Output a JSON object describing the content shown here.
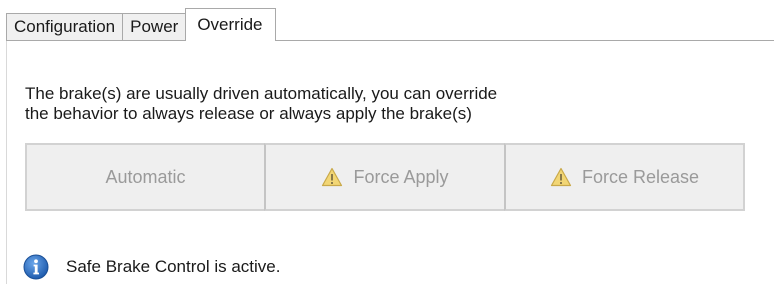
{
  "tabs": [
    {
      "label": "Configuration",
      "active": false
    },
    {
      "label": "Power",
      "active": false
    },
    {
      "label": "Override",
      "active": true
    }
  ],
  "description": {
    "line1": "The brake(s) are usually driven automatically, you can override",
    "line2": "the behavior to always release or always apply the brake(s)"
  },
  "override_buttons": {
    "automatic": {
      "label": "Automatic",
      "icon": null,
      "enabled": false
    },
    "force_apply": {
      "label": "Force Apply",
      "icon": "warning-icon",
      "enabled": false
    },
    "force_release": {
      "label": "Force Release",
      "icon": "warning-icon",
      "enabled": false
    }
  },
  "status": {
    "icon": "info-icon",
    "text": "Safe Brake Control is active."
  },
  "colors": {
    "info_blue": "#2f6fc4",
    "warning_yellow": "#f2d675",
    "disabled_text": "#9a9a9a",
    "button_bg": "#efefef"
  }
}
